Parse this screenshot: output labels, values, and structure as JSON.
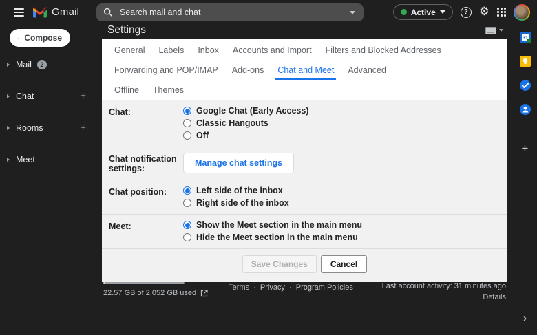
{
  "topbar": {
    "app_name": "Gmail",
    "search_placeholder": "Search mail and chat",
    "status": "Active"
  },
  "icons": {
    "help": "?",
    "gear": "⚙",
    "sidebar_add": "+",
    "rail_add": "+",
    "collapse_chevron": "›"
  },
  "sidebar": {
    "compose_label": "Compose",
    "items": [
      {
        "label": "Mail",
        "badge": "2"
      },
      {
        "label": "Chat"
      },
      {
        "label": "Rooms"
      },
      {
        "label": "Meet"
      }
    ]
  },
  "settings": {
    "title": "Settings",
    "tabs": [
      "General",
      "Labels",
      "Inbox",
      "Accounts and Import",
      "Filters and Blocked Addresses",
      "Forwarding and POP/IMAP",
      "Add-ons",
      "Chat and Meet",
      "Advanced",
      "Offline",
      "Themes"
    ],
    "active_tab": "Chat and Meet",
    "rows": [
      {
        "label": "Chat:",
        "options": [
          {
            "label": "Google Chat (Early Access)",
            "selected": true
          },
          {
            "label": "Classic Hangouts",
            "selected": false
          },
          {
            "label": "Off",
            "selected": false
          }
        ]
      },
      {
        "label": "Chat notification settings:",
        "button": "Manage chat settings"
      },
      {
        "label": "Chat position:",
        "options": [
          {
            "label": "Left side of the inbox",
            "selected": true
          },
          {
            "label": "Right side of the inbox",
            "selected": false
          }
        ]
      },
      {
        "label": "Meet:",
        "options": [
          {
            "label": "Show the Meet section in the main menu",
            "selected": true
          },
          {
            "label": "Hide the Meet section in the main menu",
            "selected": false
          }
        ]
      }
    ],
    "actions": {
      "save": "Save Changes",
      "save_disabled": true,
      "cancel": "Cancel"
    }
  },
  "footer": {
    "storage_text": "22.57 GB of 2,052 GB used",
    "terms": "Terms",
    "privacy": "Privacy",
    "policies": "Program Policies",
    "separator": "·",
    "activity": "Last account activity: 31 minutes ago",
    "details": "Details"
  },
  "colors": {
    "accent_blue": "#1a73e8",
    "status_green": "#34a853",
    "background_dark": "#1f1f1f",
    "card_white": "#ffffff",
    "card_gray": "#f1f1f1"
  }
}
